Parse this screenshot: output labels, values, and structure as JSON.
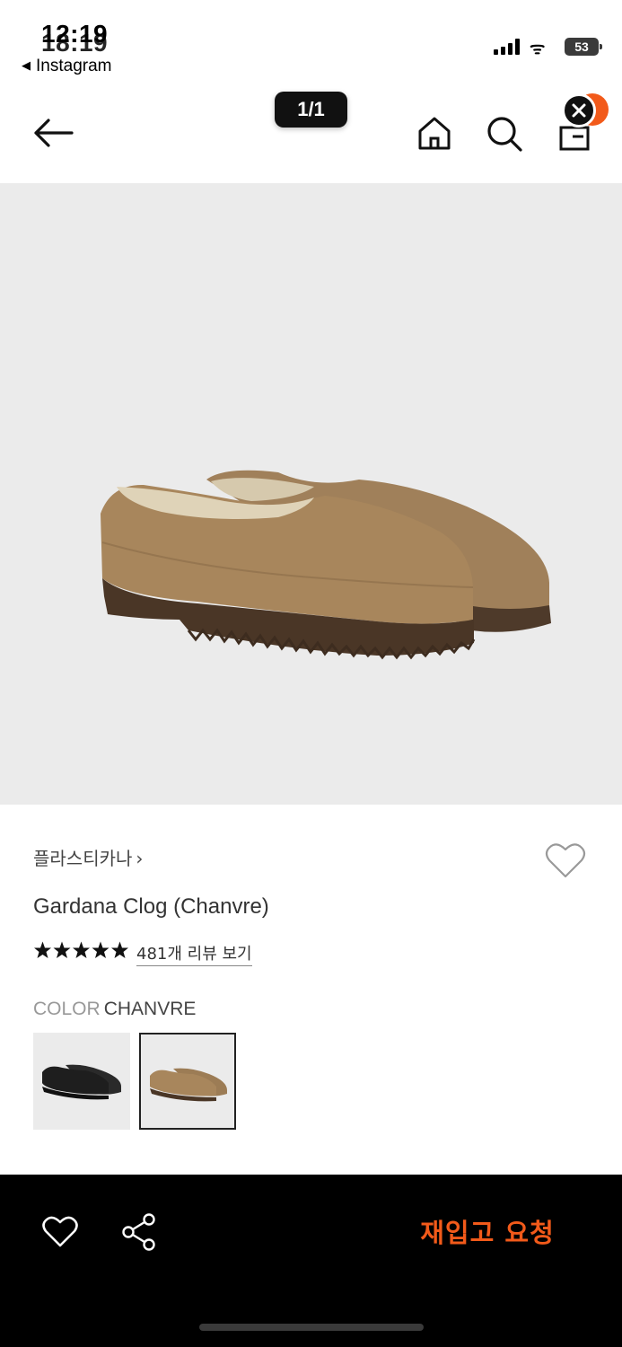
{
  "status_bar": {
    "time": "12:19",
    "time_overlap": "18:19",
    "back_app": "Instagram",
    "battery": "53"
  },
  "nav": {
    "page_counter": "1/1"
  },
  "product": {
    "brand": "플라스티카나",
    "brand_chevron": "›",
    "name": "Gardana Clog (Chanvre)",
    "rating": 5,
    "review_link": "481개 리뷰 보기",
    "color_label": "COLOR",
    "color_value": "CHANVRE",
    "swatches": [
      {
        "name": "black",
        "selected": false,
        "color": "#1e1e1e"
      },
      {
        "name": "chanvre",
        "selected": true,
        "color": "#a8865c"
      }
    ]
  },
  "bottom_bar": {
    "restock_label": "재입고 요청"
  },
  "colors": {
    "accent": "#f25a1a",
    "hero_bg": "#ebebeb",
    "shoe": "#a8865c"
  }
}
